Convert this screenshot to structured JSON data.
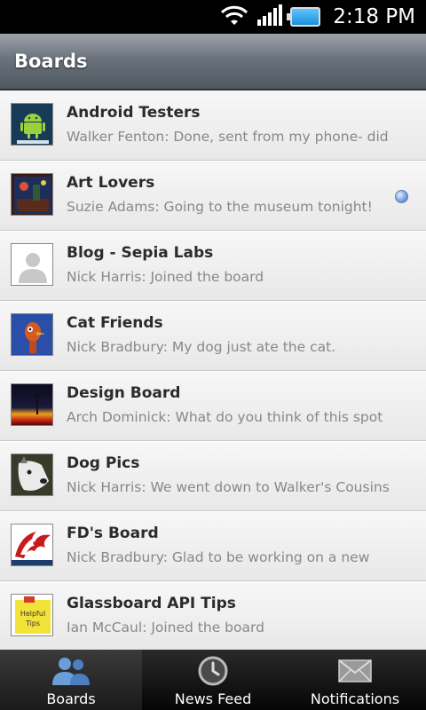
{
  "status_bar": {
    "time": "2:18 PM"
  },
  "header": {
    "title": "Boards"
  },
  "boards": [
    {
      "title": "Android Testers",
      "subtitle": "Walker Fenton: Done, sent from my phone- did",
      "thumb_icon": "android-logo",
      "unread": false
    },
    {
      "title": "Art Lovers",
      "subtitle": "Suzie Adams: Going to the museum tonight!",
      "thumb_icon": "art-painting",
      "unread": true
    },
    {
      "title": "Blog - Sepia Labs",
      "subtitle": "Nick Harris: Joined the board",
      "thumb_icon": "default-avatar",
      "unread": false
    },
    {
      "title": "Cat Friends",
      "subtitle": "Nick Bradbury: My dog just ate the cat.",
      "thumb_icon": "cartoon-bird",
      "unread": false
    },
    {
      "title": "Design Board",
      "subtitle": "Arch Dominick: What do you think of this spot",
      "thumb_icon": "sunset-photo",
      "unread": false
    },
    {
      "title": "Dog Pics",
      "subtitle": "Nick Harris: We went down to Walker's Cousins",
      "thumb_icon": "dog-photo",
      "unread": false
    },
    {
      "title": "FD's Board",
      "subtitle": "Nick Bradbury: Glad to be working on a new",
      "thumb_icon": "flame-logo",
      "unread": false
    },
    {
      "title": "Glassboard API Tips",
      "subtitle": "Ian McCaul: Joined the board",
      "thumb_icon": "sticky-note",
      "thumb_text": "Helpful Tips",
      "unread": false
    }
  ],
  "tabs": [
    {
      "label": "Boards",
      "icon": "people-icon",
      "active": true
    },
    {
      "label": "News Feed",
      "icon": "clock-icon",
      "active": false
    },
    {
      "label": "Notifications",
      "icon": "envelope-icon",
      "active": false
    }
  ],
  "colors": {
    "unread_dot": "#7aa3e0",
    "header": "#6a727c"
  }
}
